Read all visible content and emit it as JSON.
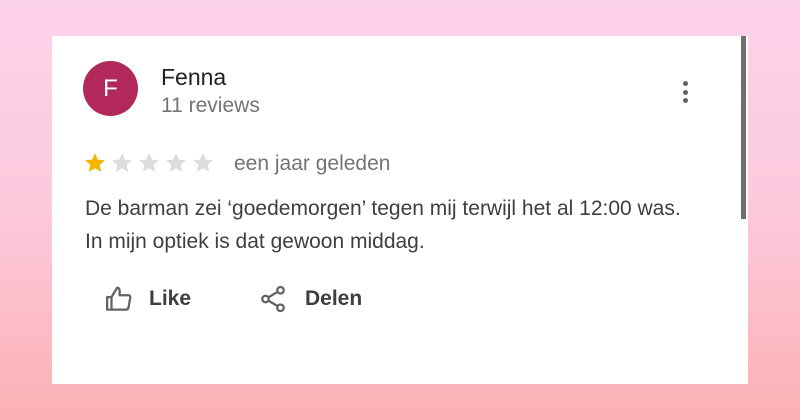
{
  "review": {
    "author": {
      "initial": "F",
      "name": "Fenna",
      "meta": "11 reviews",
      "avatar_color": "#b3285a"
    },
    "rating": {
      "value": 1,
      "max": 5,
      "filled_color": "#f4b400",
      "empty_color": "#dadce0"
    },
    "time": "een jaar geleden",
    "text": "De barman zei ‘goedemorgen’ tegen mij terwijl het al 12:00 was. In mijn optiek is dat gewoon middag.",
    "menu_icon": "more-vert-icon"
  },
  "actions": {
    "like": {
      "label": "Like",
      "icon": "thumb-up-icon"
    },
    "share": {
      "label": "Delen",
      "icon": "share-icon"
    }
  }
}
